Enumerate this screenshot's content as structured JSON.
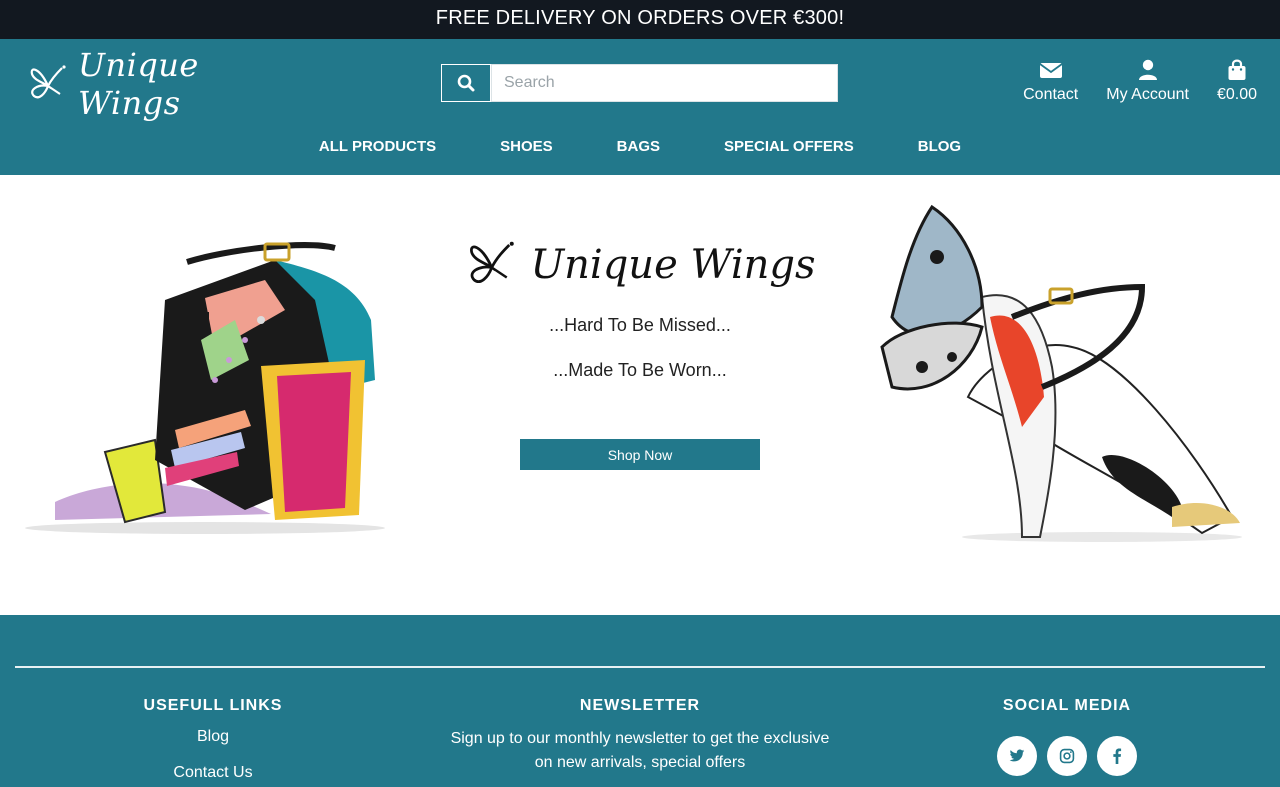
{
  "banner": {
    "text": "FREE DELIVERY ON ORDERS OVER €300!"
  },
  "brand": {
    "name": "Unique Wings"
  },
  "search": {
    "placeholder": "Search",
    "value": ""
  },
  "header_links": {
    "contact": "Contact",
    "account": "My Account",
    "cart": "€0.00"
  },
  "nav": {
    "items": [
      "ALL PRODUCTS",
      "SHOES",
      "BAGS",
      "SPECIAL OFFERS",
      "BLOG"
    ]
  },
  "hero": {
    "tagline_1": "...Hard To Be Missed...",
    "tagline_2": "...Made To Be Worn...",
    "cta": "Shop Now"
  },
  "footer": {
    "links_title": "USEFULL LINKS",
    "links": [
      "Blog",
      "Contact Us"
    ],
    "newsletter_title": "NEWSLETTER",
    "newsletter_text": "Sign up to our monthly newsletter to get the exclusive on new arrivals, special offers",
    "social_title": "SOCIAL MEDIA",
    "social": [
      "twitter-icon",
      "instagram-icon",
      "facebook-icon"
    ]
  },
  "colors": {
    "brand": "#22788b",
    "banner": "#121820",
    "white": "#ffffff"
  }
}
